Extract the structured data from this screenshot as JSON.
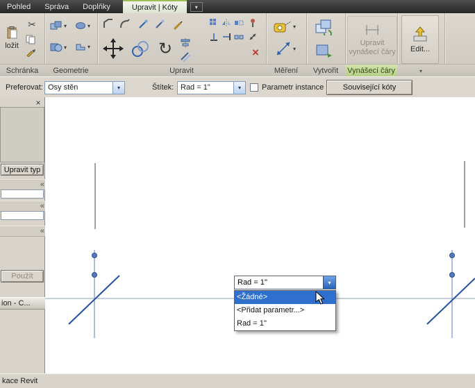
{
  "menu": {
    "tabs": [
      {
        "label": "Pohled"
      },
      {
        "label": "Správa"
      },
      {
        "label": "Doplňky"
      },
      {
        "label": "Upravit | Kóty"
      }
    ]
  },
  "ribbon": {
    "groups": [
      {
        "label": "Schránka"
      },
      {
        "label": "Geometrie"
      },
      {
        "label": "Upravit"
      },
      {
        "label": "Měření"
      },
      {
        "label": "Vytvořit"
      },
      {
        "label": "Vynášecí čáry"
      }
    ],
    "paste_label": "ložit",
    "witness_line1": "Upravit",
    "witness_line2": "vynášecí čáry",
    "edit_label": "Edit..."
  },
  "options_bar": {
    "prefer_label": "Preferovat:",
    "prefer_value": "Osy stěn",
    "tag_label": "Štítek:",
    "tag_value": "Rad = 1\"",
    "instance_param_label": "Parametr instance",
    "instance_param_checked": false,
    "related_dims_button": "Související kóty"
  },
  "properties_panel": {
    "edit_type_button": "Upravit typ",
    "apply_button": "Použít",
    "docked_title": "ion - C..."
  },
  "status_bar": {
    "text": "kace Revit"
  },
  "canvas": {
    "dimension_combo": {
      "value": "Rad = 1''",
      "options": [
        "<Žádné>",
        "<Přidat parametr...>",
        "Rad = 1''"
      ],
      "highlighted": "<Žádné>"
    }
  },
  "icons": {
    "caret": "▾",
    "scissors": "✂",
    "rotate": "↻",
    "close": "×",
    "chevron": "«",
    "delete_x": "×"
  },
  "colors": {
    "highlight_blue": "#2f6fce",
    "contextual_green": "#b7cd86",
    "line_blue": "#23509f",
    "witness_blue": "#5b79bb"
  }
}
